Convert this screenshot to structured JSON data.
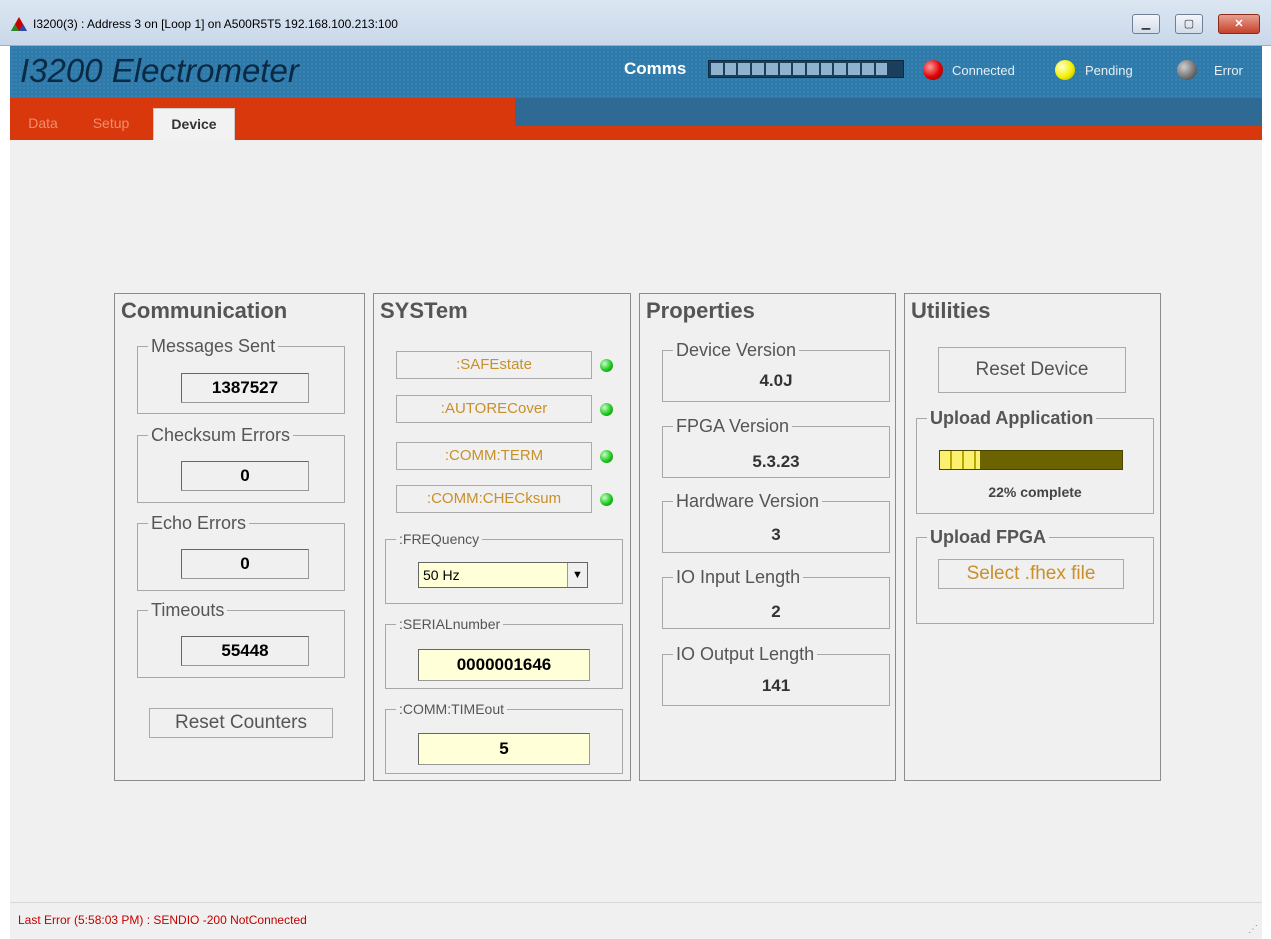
{
  "window": {
    "title": "I3200(3) : Address 3 on [Loop 1] on A500R5T5 192.168.100.213:100"
  },
  "header": {
    "app_title": "I3200 Electrometer",
    "comms_label": "Comms",
    "connected_label": "Connected",
    "pending_label": "Pending",
    "error_label": "Error"
  },
  "tabs": [
    {
      "label": "Data",
      "active": false
    },
    {
      "label": "Setup",
      "active": false
    },
    {
      "label": "Device",
      "active": true
    }
  ],
  "communication": {
    "title": "Communication",
    "messages_sent_label": "Messages Sent",
    "messages_sent": "1387527",
    "checksum_errors_label": "Checksum Errors",
    "checksum_errors": "0",
    "echo_errors_label": "Echo Errors",
    "echo_errors": "0",
    "timeouts_label": "Timeouts",
    "timeouts": "55448",
    "reset_label": "Reset Counters"
  },
  "system": {
    "title": "SYSTem",
    "buttons": [
      ":SAFEstate",
      ":AUTORECover",
      ":COMM:TERM",
      ":COMM:CHECksum"
    ],
    "frequency_label": ":FREQuency",
    "frequency_value": "50 Hz",
    "serial_label": ":SERIALnumber",
    "serial_value": "0000001646",
    "timeout_label": ":COMM:TIMEout",
    "timeout_value": "5"
  },
  "properties": {
    "title": "Properties",
    "device_version_label": "Device Version",
    "device_version": "4.0J",
    "fpga_version_label": "FPGA Version",
    "fpga_version": "5.3.23",
    "hardware_version_label": "Hardware Version",
    "hardware_version": "3",
    "io_input_label": "IO Input Length",
    "io_input": "2",
    "io_output_label": "IO Output Length",
    "io_output": "141"
  },
  "utilities": {
    "title": "Utilities",
    "reset_device_label": "Reset Device",
    "upload_app_label": "Upload Application",
    "upload_progress": 0.22,
    "upload_progress_text": "22% complete",
    "upload_fpga_label": "Upload FPGA",
    "select_fhex_label": "Select .fhex file"
  },
  "status": {
    "last_error": "Last Error (5:58:03 PM) :  SENDIO -200 NotConnected"
  },
  "colors": {
    "header_blue": "#2e7aaa",
    "tab_red": "#d9380c",
    "error_red": "#c40000",
    "sys_button_text": "#c8902a"
  },
  "comms_activity": {
    "filled_segments": 13,
    "total_segments": 14
  }
}
